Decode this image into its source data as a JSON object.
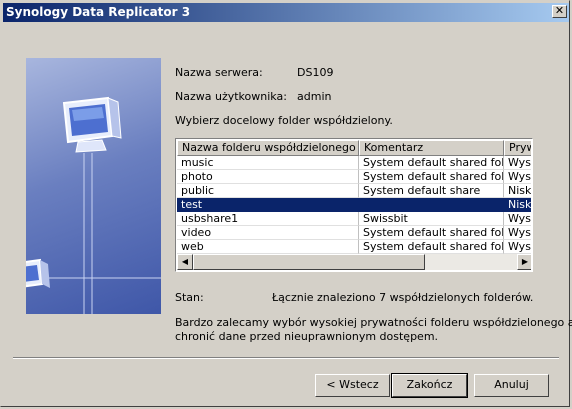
{
  "window": {
    "title": "Synology Data Replicator 3",
    "close_glyph": "✕"
  },
  "info": {
    "server_label": "Nazwa serwera:",
    "server_value": "DS109",
    "user_label": "Nazwa użytkownika:",
    "user_value": "admin",
    "prompt": "Wybierz docelowy folder współdzielony."
  },
  "table": {
    "columns": [
      "Nazwa folderu współdzielonego",
      "Komentarz",
      "Prywatność"
    ],
    "rows": [
      {
        "name": "music",
        "comment": "System default shared folder",
        "privacy": "Wysoka"
      },
      {
        "name": "photo",
        "comment": "System default shared folder",
        "privacy": "Wysoka"
      },
      {
        "name": "public",
        "comment": "System default share",
        "privacy": "Niska"
      },
      {
        "name": "test",
        "comment": "",
        "privacy": "Niska"
      },
      {
        "name": "usbshare1",
        "comment": "Swissbit",
        "privacy": "Wysoka"
      },
      {
        "name": "video",
        "comment": "System default shared folder",
        "privacy": "Wysoka"
      },
      {
        "name": "web",
        "comment": "System default shared folder",
        "privacy": "Wysoka"
      }
    ],
    "selected_index": 3
  },
  "status": {
    "label": "Stan:",
    "value": "Łącznie znaleziono 7 współdzielonych folderów."
  },
  "advice": {
    "line1": "Bardzo zalecamy wybór wysokiej prywatności folderu współdzielonego aby",
    "line2": "chronić dane przed nieuprawnionym dostępem."
  },
  "buttons": {
    "back": "< Wstecz",
    "finish": "Zakończ",
    "cancel": "Anuluj"
  },
  "colors": {
    "titlebar": "#0a246a",
    "selection": "#0a246a",
    "face": "#d4d0c8"
  },
  "icons": {
    "art": "monitor-icon",
    "scroll_left": "arrow-left-icon",
    "scroll_right": "arrow-right-icon"
  }
}
